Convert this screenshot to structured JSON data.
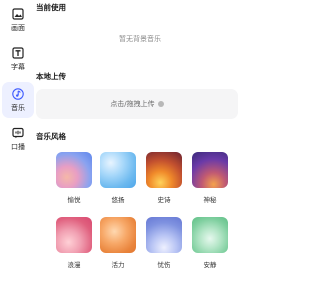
{
  "sidebar": {
    "items": [
      {
        "label": "画面",
        "icon": "image-icon"
      },
      {
        "label": "字幕",
        "icon": "text-t-icon"
      },
      {
        "label": "音乐",
        "icon": "music-note-icon",
        "active": true
      },
      {
        "label": "口播",
        "icon": "voice-bubble-icon"
      }
    ]
  },
  "current": {
    "title": "当前使用",
    "empty_text": "暂无背景音乐"
  },
  "upload": {
    "title": "本地上传",
    "button_label": "点击/拖拽上传"
  },
  "styles": {
    "title": "音乐风格",
    "items": [
      {
        "label": "愉悦"
      },
      {
        "label": "悠扬"
      },
      {
        "label": "史诗"
      },
      {
        "label": "神秘"
      },
      {
        "label": "浪漫"
      },
      {
        "label": "活力"
      },
      {
        "label": "忧伤"
      },
      {
        "label": "安静"
      }
    ]
  },
  "colors": {
    "accent": "#3d5afe",
    "active_bg": "#edf0ff"
  }
}
